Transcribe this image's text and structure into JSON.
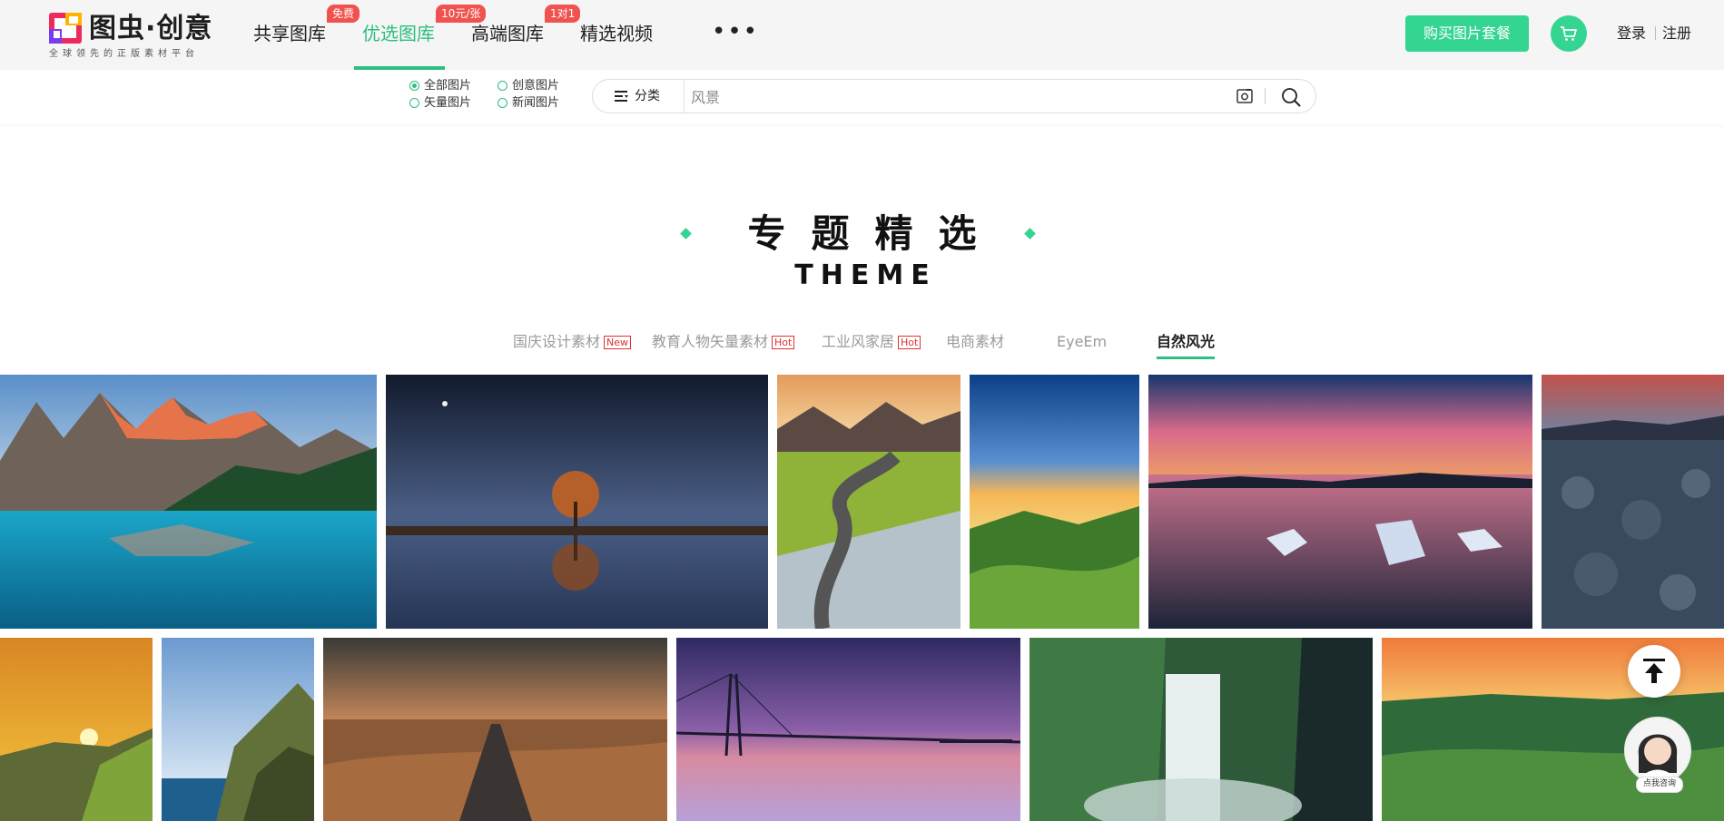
{
  "header": {
    "logo": {
      "name": "图虫·创意",
      "slogan": "全球领先的正版素材平台"
    },
    "nav": [
      {
        "label": "共享图库",
        "badge": "免费"
      },
      {
        "label": "优选图库",
        "badge": "10元/张",
        "active": true
      },
      {
        "label": "高端图库",
        "badge": "1对1"
      },
      {
        "label": "精选视频",
        "badge": ""
      }
    ],
    "more_label": "•••",
    "buy_button": "购买图片套餐",
    "cart_icon": "cart-icon",
    "login": "登录",
    "register": "注册",
    "accent_color": "#34d491",
    "badge_color": "#f0524f"
  },
  "search": {
    "scopes": [
      {
        "label": "全部图片",
        "checked": true
      },
      {
        "label": "创意图片",
        "checked": false
      },
      {
        "label": "矢量图片",
        "checked": false
      },
      {
        "label": "新闻图片",
        "checked": false
      }
    ],
    "category_label": "分类",
    "placeholder": "风景"
  },
  "theme": {
    "title": "专题精选",
    "subtitle": "THEME",
    "tabs": [
      {
        "label": "国庆设计素材",
        "tag": "New"
      },
      {
        "label": "教育人物矢量素材",
        "tag": "Hot"
      },
      {
        "label": "工业风家居",
        "tag": "Hot"
      },
      {
        "label": "电商素材",
        "tag": ""
      },
      {
        "label": "EyeEm",
        "tag": ""
      },
      {
        "label": "自然风光",
        "tag": "",
        "active": true
      }
    ]
  },
  "gallery": {
    "row1": [
      "mountain-lake",
      "lone-tree-reflection",
      "winding-road-hills",
      "green-hills-sunset",
      "iceberg-lagoon-sunset",
      "lava-field-dusk"
    ],
    "row2": [
      "cliff-sunset",
      "sea-cliff",
      "desert-road",
      "bridge-purple-dusk",
      "waterfall",
      "green-fields-sunset"
    ]
  },
  "widgets": {
    "back_to_top_icon": "arrow-up-icon",
    "consult_label": "点我咨询"
  }
}
